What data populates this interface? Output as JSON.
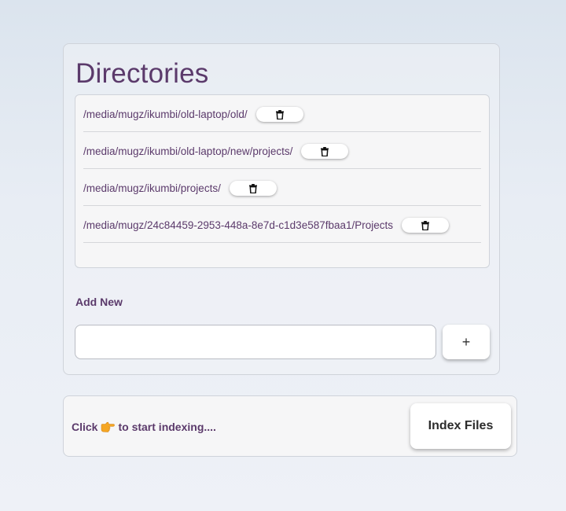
{
  "directories_panel": {
    "title": "Directories",
    "directories": [
      {
        "path": "/media/mugz/ikumbi/old-laptop/old/",
        "delete_icon": "trash-icon"
      },
      {
        "path": "/media/mugz/ikumbi/old-laptop/new/projects/",
        "delete_icon": "trash-icon"
      },
      {
        "path": "/media/mugz/ikumbi/projects/",
        "delete_icon": "trash-icon"
      },
      {
        "path": "/media/mugz/24c84459-2953-448a-8e7d-c1d3e587fbaa1/Projects",
        "delete_icon": "trash-icon"
      }
    ],
    "add_new": {
      "label": "Add New",
      "input_value": "",
      "add_button_label": "+"
    }
  },
  "indexing_panel": {
    "text_before": "Click",
    "pointer_icon": "pointing-right-hand-icon",
    "text_after": "to start indexing....",
    "button_label": "Index Files"
  },
  "colors": {
    "accent": "#5b3a6b",
    "pointer_icon": "#f5a623"
  }
}
